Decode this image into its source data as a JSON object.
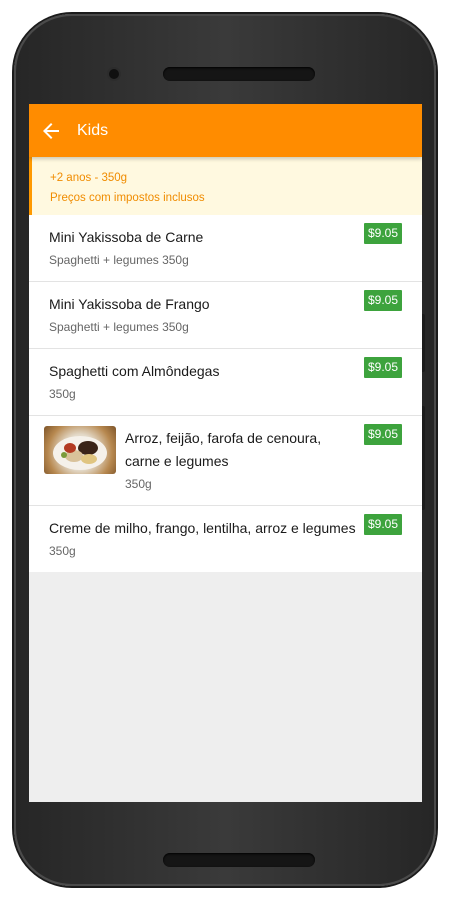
{
  "app": {
    "title": "Kids"
  },
  "info": {
    "line1": "+2 anos - 350g",
    "line2": "Preços com impostos inclusos"
  },
  "colors": {
    "appbar": "#ff8c00",
    "price_badge": "#3da33d",
    "info_bg": "#fff9e0",
    "info_text": "#f08c00"
  },
  "icons": {
    "back": "arrow-left-icon"
  },
  "items": [
    {
      "name": "Mini Yakissoba de Carne",
      "desc": "Spaghetti + legumes 350g",
      "price": "$9.05"
    },
    {
      "name": "Mini Yakissoba de Frango",
      "desc": "Spaghetti + legumes 350g",
      "price": "$9.05"
    },
    {
      "name": "Spaghetti com Almôndegas",
      "desc": "350g",
      "price": "$9.05"
    },
    {
      "name": "Arroz, feijão, farofa de cenoura, carne e legumes",
      "desc": "350g",
      "price": "$9.05"
    },
    {
      "name": "Creme de milho, frango, lentilha, arroz e legumes",
      "desc": "350g",
      "price": "$9.05"
    }
  ]
}
